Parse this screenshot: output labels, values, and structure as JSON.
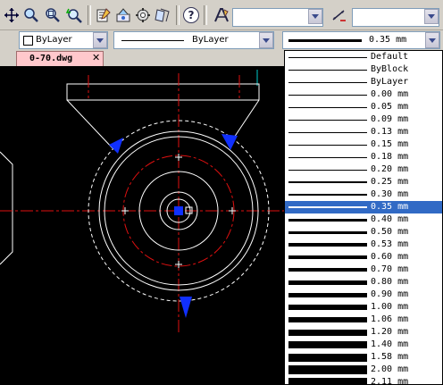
{
  "toolbar": {
    "icons": [
      "pan-icon",
      "zoom-realtime-icon",
      "zoom-window-icon",
      "zoom-previous-icon",
      "properties-icon",
      "design-center-icon",
      "tool-palettes-icon",
      "sheet-set-icon",
      "help-icon",
      "text-style-icon",
      "dimension-style-icon"
    ],
    "help_label": "?"
  },
  "properties_bar": {
    "color_value": "ByLayer",
    "linetype_value": "ByLayer",
    "lineweight_value": "0.35 mm"
  },
  "document_tab": {
    "label": "0-70.dwg"
  },
  "lineweight_list": {
    "selected": "0.35 mm",
    "items": [
      {
        "label": "Default"
      },
      {
        "label": "ByBlock"
      },
      {
        "label": "ByLayer"
      },
      {
        "label": "0.00 mm"
      },
      {
        "label": "0.05 mm"
      },
      {
        "label": "0.09 mm"
      },
      {
        "label": "0.13 mm"
      },
      {
        "label": "0.15 mm"
      },
      {
        "label": "0.18 mm"
      },
      {
        "label": "0.20 mm"
      },
      {
        "label": "0.25 mm"
      },
      {
        "label": "0.30 mm"
      },
      {
        "label": "0.35 mm"
      },
      {
        "label": "0.40 mm"
      },
      {
        "label": "0.50 mm"
      },
      {
        "label": "0.53 mm"
      },
      {
        "label": "0.60 mm"
      },
      {
        "label": "0.70 mm"
      },
      {
        "label": "0.80 mm"
      },
      {
        "label": "0.90 mm"
      },
      {
        "label": "1.00 mm"
      },
      {
        "label": "1.06 mm"
      },
      {
        "label": "1.20 mm"
      },
      {
        "label": "1.40 mm"
      },
      {
        "label": "1.58 mm"
      },
      {
        "label": "2.00 mm"
      },
      {
        "label": "2.11 mm"
      }
    ]
  },
  "colors": {
    "selection": "#316ac5",
    "tab": "#ffc8cc",
    "canvas": "#000000",
    "centerline": "#e01010",
    "grip": "#1030ff"
  }
}
